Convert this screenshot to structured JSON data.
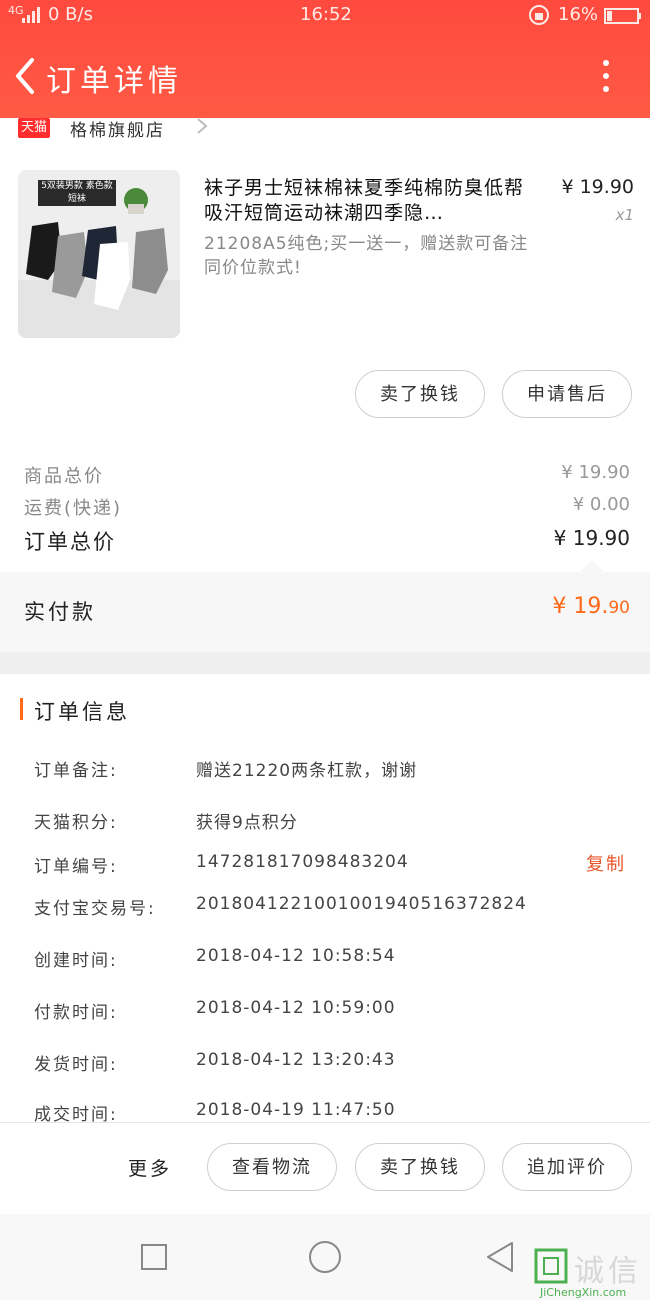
{
  "status_bar": {
    "network": "4G",
    "speed": "0 B/s",
    "time": "16:52",
    "battery": "16%"
  },
  "nav": {
    "title": "订单详情"
  },
  "store": {
    "badge": "天猫",
    "name": "格棉旗舰店"
  },
  "product": {
    "image_caption": "5双装男款 素色款短袜",
    "title": "袜子男士短袜棉袜夏季纯棉防臭低帮吸汗短筒运动袜潮四季隐…",
    "spec": "21208A5纯色;买一送一，赠送款可备注同价位款式!",
    "price": "¥ 19.90",
    "qty": "x1",
    "buttons": [
      "卖了换钱",
      "申请售后"
    ]
  },
  "totals": {
    "goods_label": "商品总价",
    "goods_value": "¥ 19.90",
    "shipping_label": "运费(快递)",
    "shipping_value": "¥ 0.00",
    "order_total_label": "订单总价",
    "order_total_value": "¥ 19.90",
    "paid_label": "实付款",
    "paid_value_main": "¥ 19.",
    "paid_value_decimal": "90"
  },
  "order_info": {
    "title": "订单信息",
    "copy_label": "复制",
    "rows": [
      {
        "label": "订单备注:",
        "value": "赠送21220两条杠款，谢谢"
      },
      {
        "label": "天猫积分:",
        "value": "获得9点积分"
      },
      {
        "label": "订单编号:",
        "value": "147281817098483204"
      },
      {
        "label": "支付宝交易号:",
        "value": "2018041221001001940516372824"
      },
      {
        "label": "创建时间:",
        "value": "2018-04-12  10:58:54"
      },
      {
        "label": "付款时间:",
        "value": "2018-04-12  10:59:00"
      },
      {
        "label": "发货时间:",
        "value": "2018-04-12  13:20:43"
      },
      {
        "label": "成交时间:",
        "value": "2018-04-19  11:47:50"
      }
    ]
  },
  "action_bar": {
    "more": "更多",
    "buttons": [
      "查看物流",
      "卖了换钱",
      "追加评价"
    ]
  },
  "watermark": {
    "text": "诚信",
    "url": "JiChengXin.com"
  },
  "colors": {
    "header": "#ff4a3f",
    "accent_orange": "#ff6a1a",
    "copy_orange": "#e8552a"
  }
}
